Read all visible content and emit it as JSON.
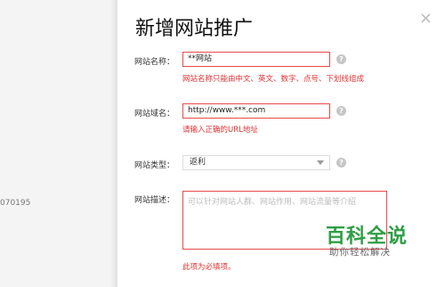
{
  "background_page": {
    "partial_text": "070195"
  },
  "dialog": {
    "title": "新增网站推广",
    "close_glyph": "×",
    "fields": {
      "name": {
        "label": "网站名称：",
        "value": "**网站",
        "error": "网站名称只能由中文、英文、数字、点号、下划线组成"
      },
      "domain": {
        "label": "网站域名：",
        "value": "http://www.***.com",
        "error": "请输入正确的URL地址"
      },
      "type": {
        "label": "网站类型：",
        "selected": "返利"
      },
      "description": {
        "label": "网站描述：",
        "placeholder": "可以针对网站人群、网站作用、网站流量等介绍",
        "error": "此项为必填项。"
      }
    },
    "help_glyph": "?"
  },
  "watermark": {
    "brand": "百科全说",
    "slogan": "助你轻松解决"
  },
  "colors": {
    "error": "#e23232",
    "error_border": "#e64b4b",
    "watermark_green": "#2e9e45"
  }
}
